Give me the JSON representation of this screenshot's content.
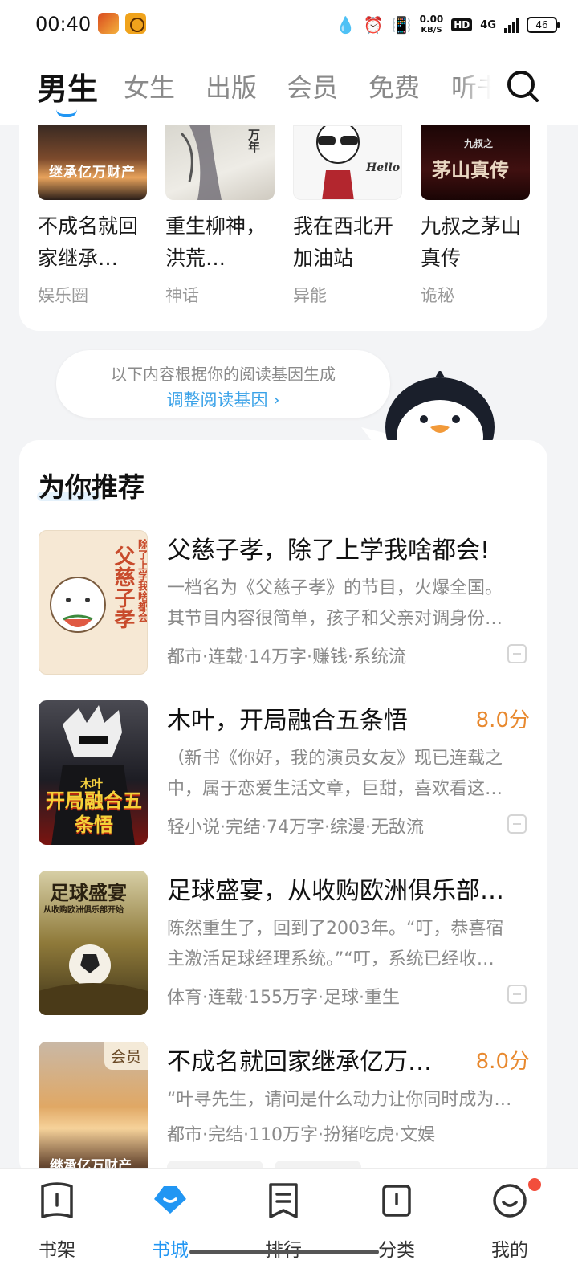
{
  "status_bar": {
    "time": "00:40",
    "net_speed_value": "0.00",
    "net_speed_unit": "KB/S",
    "hd_badge": "HD",
    "network": "4G",
    "battery": "46",
    "icons": [
      "water-drop-icon",
      "alarm-icon",
      "vibrate-icon",
      "signal-icon"
    ]
  },
  "top_tabs": [
    "男生",
    "女生",
    "出版",
    "会员",
    "免费",
    "听书"
  ],
  "active_tab": "男生",
  "strip_books": [
    {
      "title": "不成名就回家继承…",
      "tag": "娱乐圈"
    },
    {
      "title": "重生柳神，洪荒…",
      "tag": "神话"
    },
    {
      "title": "我在西北开加油站",
      "tag": "异能"
    },
    {
      "title": "九叔之茅山真传",
      "tag": "诡秘"
    }
  ],
  "strip_cover_text": [
    "继承亿万财产",
    "万年",
    "Hello",
    "茅山真传",
    "九叔之"
  ],
  "gene_bubble": {
    "note": "以下内容根据你的阅读基因生成",
    "link": "调整阅读基因 ›"
  },
  "recommend": {
    "title": "为你推荐",
    "items": [
      {
        "title": "父慈子孝，除了上学我啥都会!",
        "score": "",
        "desc1": "一档名为《父慈子孝》的节目，火爆全国。",
        "desc2": "其节目内容很简单，孩子和父亲对调身份…",
        "meta": "都市·连载·14万字·赚钱·系统流",
        "cover_text": "父慈子孝",
        "cover_sub": "除了上学我啥都会"
      },
      {
        "title": "木叶，开局融合五条悟",
        "score": "8.0分",
        "desc1": "（新书《你好，我的演员女友》现已连载之",
        "desc2": "中，属于恋爱生活文章，巨甜，喜欢看这…",
        "meta": "轻小说·完结·74万字·综漫·无敌流",
        "cover_text": "开局融合五条悟",
        "cover_sub": "木叶"
      },
      {
        "title": "足球盛宴，从收购欧洲俱乐部…",
        "score": "",
        "desc1": "陈然重生了，回到了2003年。“叮，恭喜宿",
        "desc2": "主激活足球经理系统。”“叮，系统已经收…",
        "meta": "体育·连载·155万字·足球·重生",
        "cover_text": "足球盛宴",
        "cover_sub": "从收购欧洲俱乐部开始"
      },
      {
        "title": "不成名就回家继承亿万…",
        "score": "8.0分",
        "desc1": "“叶寻先生，请问是什么动力让你同时成为…",
        "desc2": "",
        "meta": "都市·完结·110万字·扮猪吃虎·文娱",
        "cover_text": "继承亿万财产",
        "cover_sub": "",
        "vip": "会员"
      }
    ]
  },
  "bottom_nav": [
    {
      "label": "书架",
      "icon": "bookshelf-icon"
    },
    {
      "label": "书城",
      "icon": "bookstore-icon"
    },
    {
      "label": "排行",
      "icon": "ranking-icon"
    },
    {
      "label": "分类",
      "icon": "category-icon"
    },
    {
      "label": "我的",
      "icon": "profile-icon"
    }
  ],
  "active_bottom": "书城",
  "colors": {
    "accent": "#2196f3",
    "score": "#e8892f",
    "link": "#3aa2e8",
    "badge": "#f24e3c"
  }
}
